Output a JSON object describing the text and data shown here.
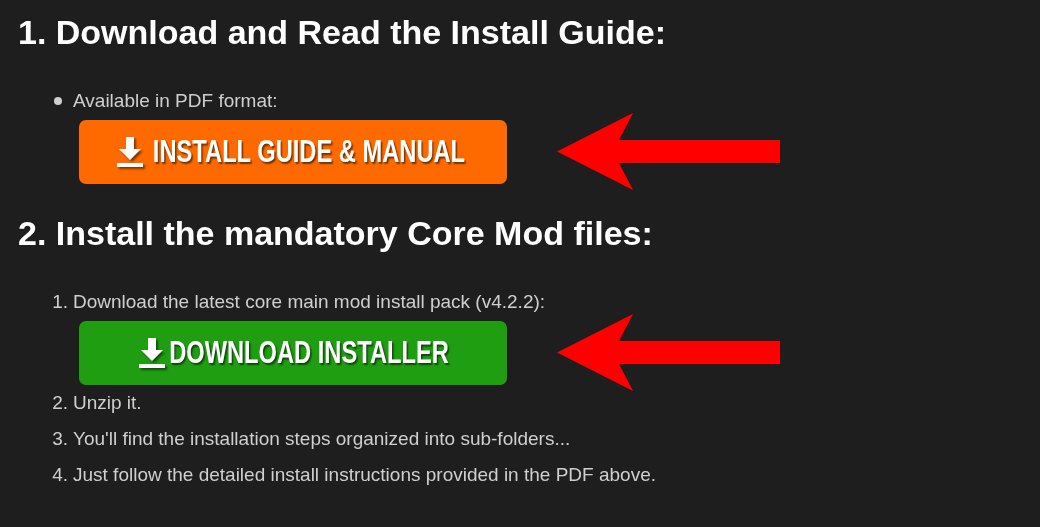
{
  "sections": [
    {
      "heading": "1. Download and Read the Install Guide:",
      "items": [
        {
          "kind": "bullet",
          "text": "Available in PDF format:"
        },
        {
          "kind": "button",
          "label": "INSTALL GUIDE & MANUAL",
          "color": "#ff6a00"
        }
      ]
    },
    {
      "heading": "2. Install the mandatory Core Mod files:",
      "items": [
        {
          "kind": "numbered",
          "marker": "1.",
          "text": "Download the latest core main mod install pack (v4.2.2):"
        },
        {
          "kind": "button",
          "label": "DOWNLOAD INSTALLER",
          "color": "#1f9e12"
        },
        {
          "kind": "numbered",
          "marker": "2.",
          "text": "Unzip it."
        },
        {
          "kind": "numbered",
          "marker": "3.",
          "text": "You'll find the installation steps organized into sub-folders..."
        },
        {
          "kind": "numbered",
          "marker": "4.",
          "text": "Just follow the detailed install instructions provided in the PDF above."
        }
      ]
    }
  ]
}
